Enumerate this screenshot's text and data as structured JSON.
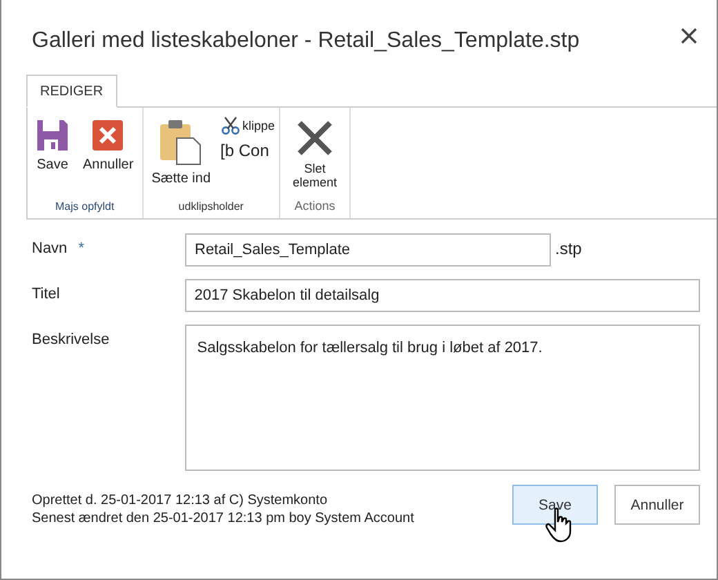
{
  "dialog": {
    "title": "Galleri med listeskabeloner - Retail_Sales_Template.stp"
  },
  "ribbon": {
    "tabs": [
      {
        "label": "REDIGER",
        "selected": true
      }
    ],
    "groups": [
      {
        "label": "Majs opfyldt",
        "commands": [
          {
            "kind": "save",
            "label": "Save"
          },
          {
            "kind": "cancel",
            "label": "Annuller"
          }
        ]
      },
      {
        "label": "udklipsholder",
        "commands": [
          {
            "kind": "paste",
            "label": "Sætte ind"
          },
          {
            "kind": "cut",
            "label": "klippe"
          },
          {
            "kind": "copy",
            "label": "[b Con"
          }
        ]
      },
      {
        "label": "Actions",
        "commands": [
          {
            "kind": "delete",
            "label": "Slet element"
          }
        ]
      }
    ]
  },
  "fields": [
    {
      "kind": "text",
      "label": "Navn",
      "required_mark": "*",
      "value": "Retail_Sales_Template",
      "suffix": ".stp"
    },
    {
      "kind": "text",
      "label": "Titel",
      "value": "2017 Skabelon til detailsalg"
    },
    {
      "kind": "textarea",
      "label": "Beskrivelse",
      "value": "Salgsskabelon for tællersalg til brug i løbet af 2017."
    }
  ],
  "footer": {
    "lines": [
      "Oprettet d. 25-01-2017 12:13 af C) Systemkonto",
      "Senest ændret den 25-01-2017 12:13 pm boy System Account"
    ],
    "buttons": [
      {
        "label": "Save",
        "highlighted": true
      },
      {
        "label": "Annuller",
        "highlighted": false
      }
    ]
  }
}
